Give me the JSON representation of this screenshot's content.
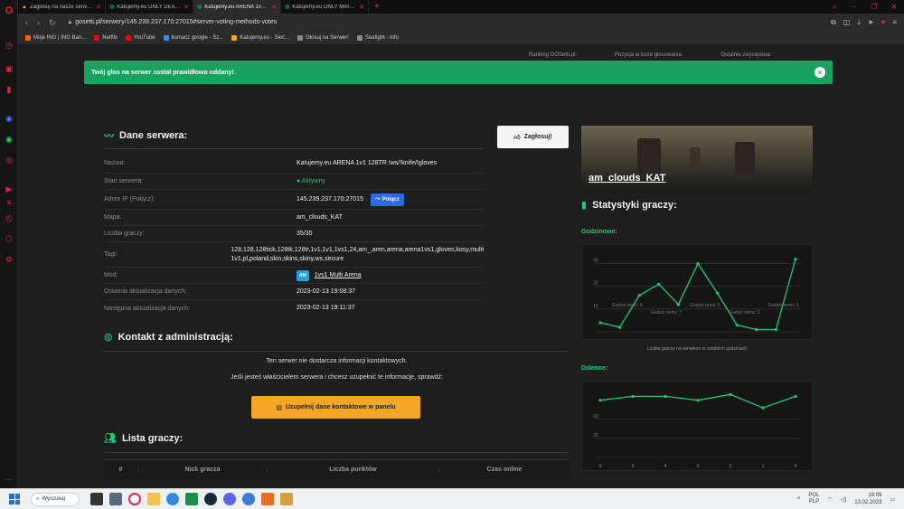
{
  "browser": {
    "tabs": [
      {
        "title": "Zagłosuj na nasze serwery",
        "icon": "gosetti-icon",
        "active": false
      },
      {
        "title": "Katujemy.eu ONLY DEAGLE",
        "icon": "server-icon",
        "active": false
      },
      {
        "title": "Katujemy.eu ARENA 1v1 12",
        "icon": "server-icon",
        "active": true
      },
      {
        "title": "Katujemy.eu ONLY MIRAGE",
        "icon": "server-icon",
        "active": false
      }
    ],
    "new_tab": "+",
    "url": "gosetti.pl/serwery/145.239.237.170:27015#server-voting-methods-votes",
    "bookmarks": [
      {
        "label": "Moje ING | ING Ban...",
        "color": "#ff6200"
      },
      {
        "label": "Netflix",
        "color": "#e50914"
      },
      {
        "label": "YouTube",
        "color": "#ff0000"
      },
      {
        "label": "tłumacz google - Sz...",
        "color": "#4285f4"
      },
      {
        "label": "Katujemy.eu - Sieć...",
        "color": "#f0b400"
      },
      {
        "label": "Głosuj na Serwer!",
        "color": "#888888"
      },
      {
        "label": "Seafight - info",
        "color": "#888888"
      }
    ]
  },
  "page": {
    "behind_header": [
      "Ranking GOSetti.pl:",
      "Pozycja w turze głosowania:",
      "Ostatnie zwycięstwa:"
    ],
    "alert": "Twój głos na serwer został prawidłowo oddany!",
    "server_section_title": "Dane serwera:",
    "vote_button": "Zagłosuj!",
    "server_info": {
      "name_label": "Nazwa:",
      "name": "Katujemy.eu ARENA 1v1 128TR !ws/!knife/!gloves",
      "status_label": "Stan serwera:",
      "status": "Aktywny",
      "ip_label": "Adres IP (Połącz):",
      "ip": "145.239.237.170:27015",
      "connect": "Połącz",
      "map_label": "Mapa:",
      "map": "am_clouds_KAT",
      "players_label": "Liczba graczy:",
      "players": "35/35",
      "tags_label": "Tagi:",
      "tags": "128,128,128tick,128tk,128tr,1v1,1v1,1vs1,24,am_,aren,arena,arena1vs1,gloves,kosy,multi 1v1,pl,poland,skin,skins,skiny,ws,secure",
      "mod_label": "Mod:",
      "mod_badge": "AM",
      "mod": "1vs1 Multi Arena",
      "last_update_label": "Ostatnia aktualizacja danych:",
      "last_update": "2023-02-13 19:08:37",
      "next_update_label": "Następna aktualizacja danych:",
      "next_update": "2023-02-13 19:11:37"
    },
    "contact_section_title": "Kontakt z administracją:",
    "contact_line1": "Ten serwer nie dostarcza informacji kontaktowych.",
    "contact_line2": "Jeśli jesteś właścicielem serwera i chcesz uzupełnić te informacje, sprawdź:",
    "panel_button": "Uzupełnij dane kontaktowe w panelu",
    "players_section_title": "Lista graczy:",
    "players_columns": [
      "#",
      "Nick gracza",
      "Liczba punktów",
      "Czas online"
    ],
    "map_card_name": "am_clouds_KAT",
    "stats_section_title": "Statystyki graczy:",
    "hourly_label": "Godzinowe:",
    "daily_label": "Dzienne:",
    "hourly_caption": "Liczba graczy na serwerze w ostatnich godzinach"
  },
  "chart_data": [
    {
      "type": "line",
      "title": "Godzinowe:",
      "caption": "Liczba graczy na serwerze w ostatnich godzinach",
      "ylim": [
        0,
        35
      ],
      "yticks": [
        10,
        20,
        30
      ],
      "x": [
        "Godzin temu: 10",
        "Godzin temu: 9",
        "Godzin temu: 8",
        "Godzin temu: 7",
        "Godzin temu: 6",
        "Godzin temu: 5",
        "Godzin temu: 4",
        "Godzin temu: 3",
        "Godzin temu: 2",
        "Godzin temu: 1",
        "Godzin temu: 0"
      ],
      "values": [
        4,
        2,
        16,
        21,
        12,
        30,
        17,
        3,
        1,
        1,
        32
      ],
      "shown_labels": [
        "Godzin temu: 9",
        "Godzin temu: 7",
        "Godzin temu: 5",
        "Godzin temu: 3",
        "Godzin temu: 1"
      ],
      "color": "#1ec87a",
      "grid": true
    },
    {
      "type": "line",
      "title": "Dzienne:",
      "ylim": [
        20,
        38
      ],
      "yticks": [
        25,
        30
      ],
      "x": [
        "6",
        "5",
        "4",
        "3",
        "2",
        "1",
        "0"
      ],
      "values": [
        35,
        36,
        36,
        35,
        36.5,
        33,
        36
      ],
      "color": "#1ec87a",
      "grid": true
    }
  ],
  "taskbar": {
    "search": "Wyszukaj",
    "lang_top": "POL",
    "lang_bottom": "PLP",
    "time": "19:09",
    "date": "13.02.2023"
  },
  "colors": {
    "accent": "#1ec87a",
    "alert": "#19a15e",
    "connect": "#2b6ae0",
    "panel_button": "#f5a623",
    "opera": "#e0284b"
  }
}
